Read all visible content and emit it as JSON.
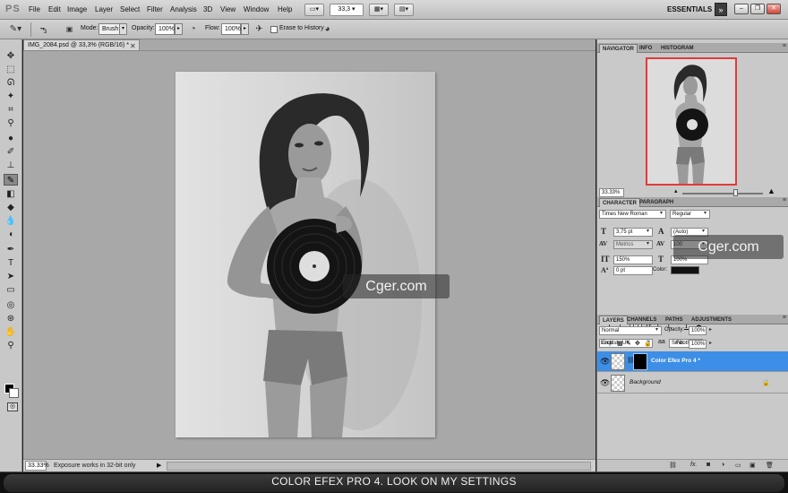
{
  "app": {
    "logo": "PS",
    "workspace": "ESSENTIALS"
  },
  "menu": [
    "File",
    "Edit",
    "Image",
    "Layer",
    "Select",
    "Filter",
    "Analysis",
    "3D",
    "View",
    "Window",
    "Help"
  ],
  "menubar_zoom": "33,3",
  "options": {
    "brush_size": "3",
    "mode_label": "Mode:",
    "mode_value": "Brush",
    "opacity_label": "Opacity:",
    "opacity_value": "100%",
    "flow_label": "Flow:",
    "flow_value": "100%",
    "erase_history_label": "Erase to History"
  },
  "document": {
    "tab_title": "IMG_2084.psd @ 33,3% (RGB/16) *",
    "zoom": "33.33%",
    "status_message": "Exposure works in 32-bit only"
  },
  "navigator": {
    "tabs": [
      "NAVIGATOR",
      "INFO",
      "HISTOGRAM"
    ],
    "zoom": "33.33%"
  },
  "character": {
    "tabs": [
      "CHARACTER",
      "PARAGRAPH"
    ],
    "font_family": "Times New Roman",
    "font_style": "Regular",
    "font_size": "3,75 pt",
    "leading": "(Auto)",
    "kerning": "Metrics",
    "tracking": "100",
    "vertical_scale": "150%",
    "horizontal_scale": "100%",
    "baseline_shift": "0 pt",
    "color_label": "Color:",
    "language": "English: UK",
    "antialias": "Smooth",
    "style_buttons": [
      "T",
      "T",
      "TT",
      "Tr",
      "T'",
      "T,",
      "T",
      "T"
    ]
  },
  "layers": {
    "tabs": [
      "LAYERS",
      "CHANNELS",
      "PATHS",
      "ADJUSTMENTS"
    ],
    "blend_mode": "Normal",
    "opacity_label": "Opacity:",
    "opacity_value": "100%",
    "lock_label": "Lock:",
    "fill_label": "Fill:",
    "fill_value": "100%",
    "items": [
      {
        "name": "Color Efex Pro 4 *",
        "selected": true
      },
      {
        "name": "Background",
        "selected": false
      }
    ]
  },
  "watermark": "Cger.com",
  "caption": "COLOR EFEX PRO 4. LOOK ON MY SETTINGS",
  "colors": {
    "selected_layer": "#3d8ee6",
    "navigator_frame": "#e23a3a"
  }
}
